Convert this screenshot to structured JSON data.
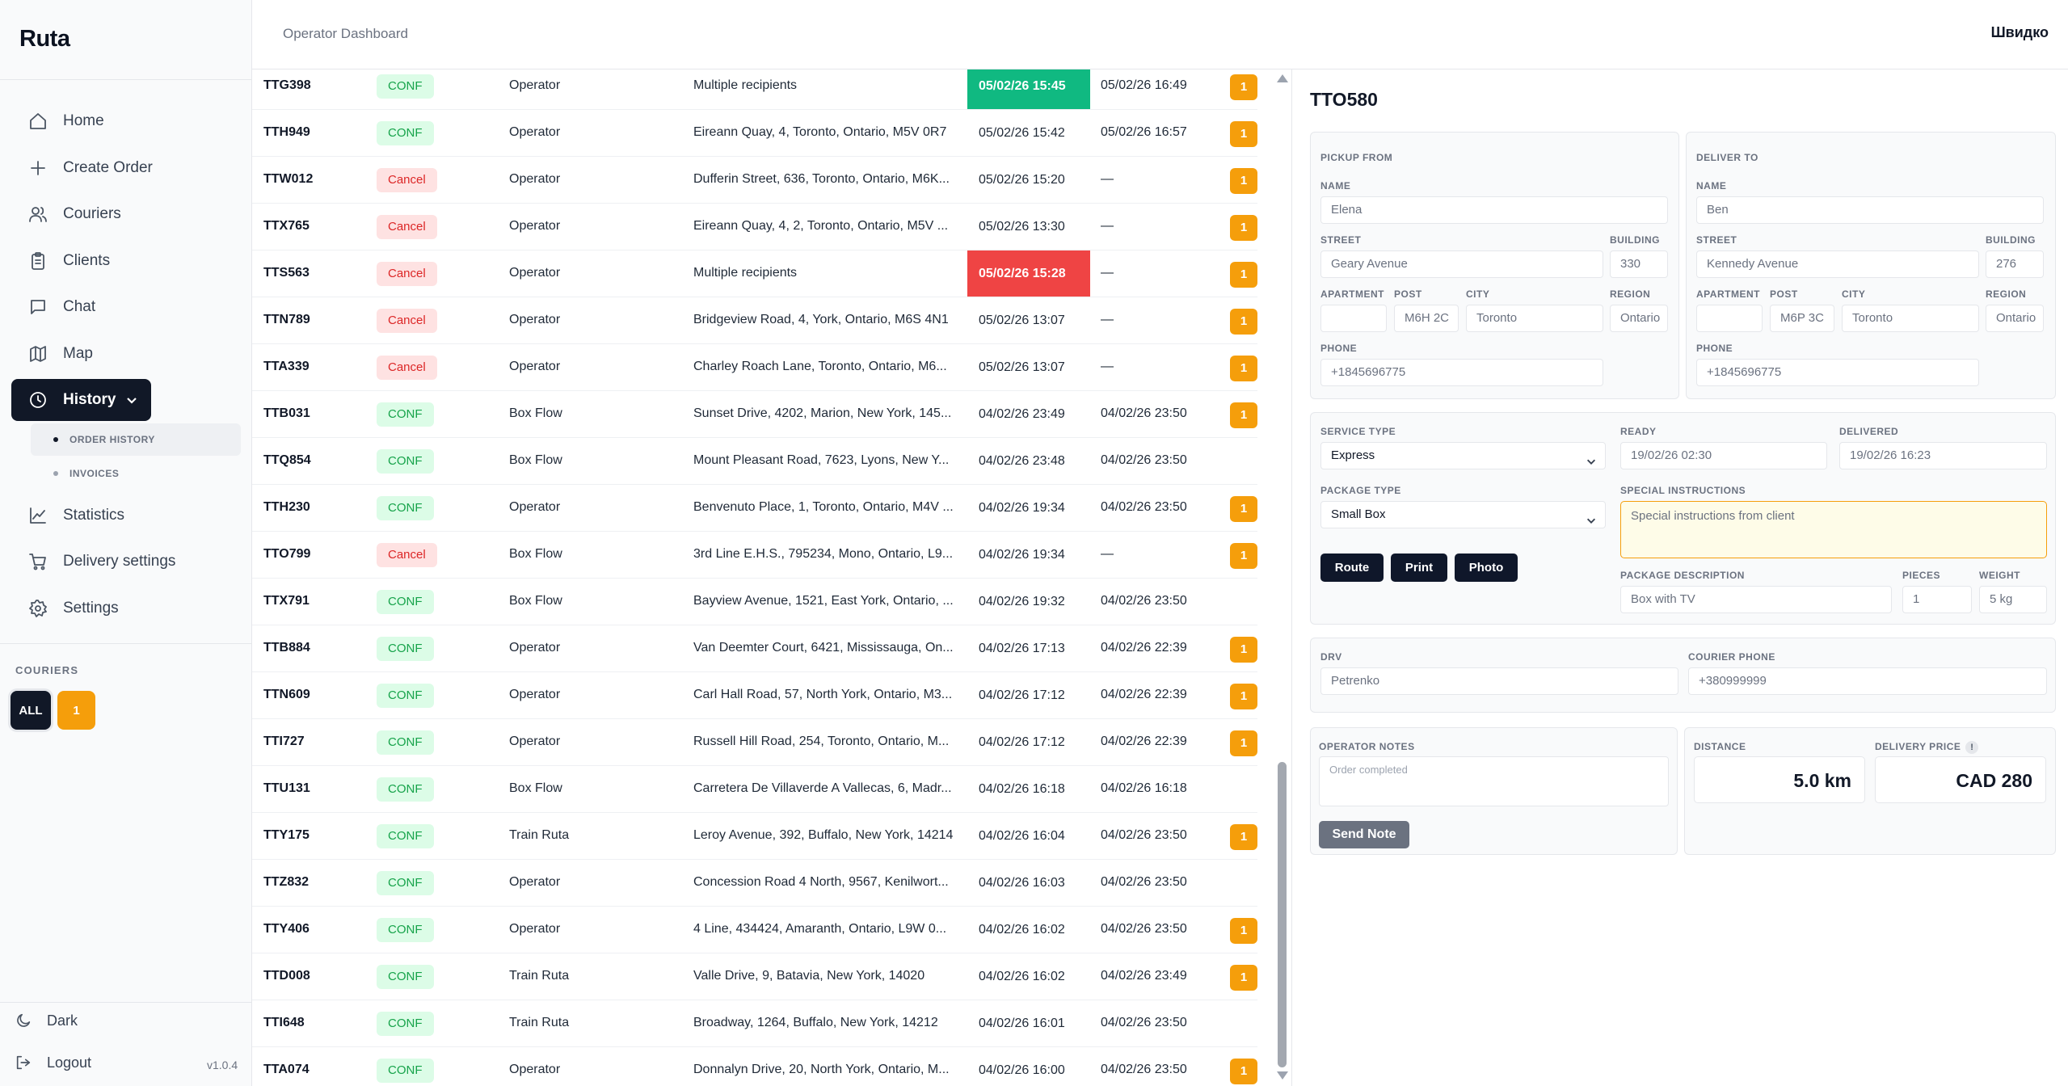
{
  "app": {
    "brand": "Ruta",
    "version": "v1.0.4"
  },
  "header": {
    "title": "Operator Dashboard",
    "lang": "Швидко"
  },
  "sidebar": {
    "items": [
      {
        "label": "Home",
        "icon": "home-icon"
      },
      {
        "label": "Create Order",
        "icon": "plus-icon"
      },
      {
        "label": "Couriers",
        "icon": "users-icon"
      },
      {
        "label": "Clients",
        "icon": "clipboard-icon"
      },
      {
        "label": "Chat",
        "icon": "chat-icon"
      },
      {
        "label": "Map",
        "icon": "map-icon"
      },
      {
        "label": "History",
        "icon": "clock-icon"
      },
      {
        "label": "Statistics",
        "icon": "chart-icon"
      },
      {
        "label": "Delivery settings",
        "icon": "cart-icon"
      },
      {
        "label": "Settings",
        "icon": "gear-icon"
      }
    ],
    "sub_items": [
      {
        "label": "Order History"
      },
      {
        "label": "Invoices"
      }
    ],
    "couriers_title": "COURIERS",
    "courier_all": "ALL",
    "courier_one": "1",
    "dark_label": "Dark",
    "logout_label": "Logout"
  },
  "orders": [
    {
      "id": "TTG398",
      "status": "CONF",
      "source": "Operator",
      "address": "Multiple recipients",
      "time1": "05/02/26 15:45",
      "time2": "05/02/26 16:49",
      "badge": "1",
      "highlight": "green"
    },
    {
      "id": "TTH949",
      "status": "CONF",
      "source": "Operator",
      "address": "Eireann Quay, 4, Toronto, Ontario, M5V 0R7",
      "time1": "05/02/26 15:42",
      "time2": "05/02/26 16:57",
      "badge": "1",
      "highlight": ""
    },
    {
      "id": "TTW012",
      "status": "Cancel",
      "source": "Operator",
      "address": "Dufferin Street, 636, Toronto, Ontario, M6K...",
      "time1": "05/02/26 15:20",
      "time2": "—",
      "badge": "1",
      "highlight": ""
    },
    {
      "id": "TTX765",
      "status": "Cancel",
      "source": "Operator",
      "address": "Eireann Quay, 4, 2, Toronto, Ontario, M5V ...",
      "time1": "05/02/26 13:30",
      "time2": "—",
      "badge": "1",
      "highlight": ""
    },
    {
      "id": "TTS563",
      "status": "Cancel",
      "source": "Operator",
      "address": "Multiple recipients",
      "time1": "05/02/26 15:28",
      "time2": "—",
      "badge": "1",
      "highlight": "red"
    },
    {
      "id": "TTN789",
      "status": "Cancel",
      "source": "Operator",
      "address": "Bridgeview Road, 4, York, Ontario, M6S 4N1",
      "time1": "05/02/26 13:07",
      "time2": "—",
      "badge": "1",
      "highlight": ""
    },
    {
      "id": "TTA339",
      "status": "Cancel",
      "source": "Operator",
      "address": "Charley Roach Lane, Toronto, Ontario, M6...",
      "time1": "05/02/26 13:07",
      "time2": "—",
      "badge": "1",
      "highlight": ""
    },
    {
      "id": "TTB031",
      "status": "CONF",
      "source": "Box Flow",
      "address": "Sunset Drive, 4202, Marion, New York, 145...",
      "time1": "04/02/26 23:49",
      "time2": "04/02/26 23:50",
      "badge": "1",
      "highlight": ""
    },
    {
      "id": "TTQ854",
      "status": "CONF",
      "source": "Box Flow",
      "address": "Mount Pleasant Road, 7623, Lyons, New Y...",
      "time1": "04/02/26 23:48",
      "time2": "04/02/26 23:50",
      "badge": "",
      "highlight": ""
    },
    {
      "id": "TTH230",
      "status": "CONF",
      "source": "Operator",
      "address": "Benvenuto Place, 1, Toronto, Ontario, M4V ...",
      "time1": "04/02/26 19:34",
      "time2": "04/02/26 23:50",
      "badge": "1",
      "highlight": ""
    },
    {
      "id": "TTO799",
      "status": "Cancel",
      "source": "Box Flow",
      "address": "3rd Line E.H.S., 795234, Mono, Ontario, L9...",
      "time1": "04/02/26 19:34",
      "time2": "—",
      "badge": "1",
      "highlight": ""
    },
    {
      "id": "TTX791",
      "status": "CONF",
      "source": "Box Flow",
      "address": "Bayview Avenue, 1521, East York, Ontario, ...",
      "time1": "04/02/26 19:32",
      "time2": "04/02/26 23:50",
      "badge": "",
      "highlight": ""
    },
    {
      "id": "TTB884",
      "status": "CONF",
      "source": "Operator",
      "address": "Van Deemter Court, 6421, Mississauga, On...",
      "time1": "04/02/26 17:13",
      "time2": "04/02/26 22:39",
      "badge": "1",
      "highlight": ""
    },
    {
      "id": "TTN609",
      "status": "CONF",
      "source": "Operator",
      "address": "Carl Hall Road, 57, North York, Ontario, M3...",
      "time1": "04/02/26 17:12",
      "time2": "04/02/26 22:39",
      "badge": "1",
      "highlight": ""
    },
    {
      "id": "TTI727",
      "status": "CONF",
      "source": "Operator",
      "address": "Russell Hill Road, 254, Toronto, Ontario, M...",
      "time1": "04/02/26 17:12",
      "time2": "04/02/26 22:39",
      "badge": "1",
      "highlight": ""
    },
    {
      "id": "TTU131",
      "status": "CONF",
      "source": "Box Flow",
      "address": "Carretera De Villaverde A Vallecas, 6, Madr...",
      "time1": "04/02/26 16:18",
      "time2": "04/02/26 16:18",
      "badge": "",
      "highlight": ""
    },
    {
      "id": "TTY175",
      "status": "CONF",
      "source": "Train Ruta",
      "address": "Leroy Avenue, 392, Buffalo, New York, 14214",
      "time1": "04/02/26 16:04",
      "time2": "04/02/26 23:50",
      "badge": "1",
      "highlight": ""
    },
    {
      "id": "TTZ832",
      "status": "CONF",
      "source": "Operator",
      "address": "Concession Road 4 North, 9567, Kenilwort...",
      "time1": "04/02/26 16:03",
      "time2": "04/02/26 23:50",
      "badge": "",
      "highlight": ""
    },
    {
      "id": "TTY406",
      "status": "CONF",
      "source": "Operator",
      "address": "4 Line, 434424, Amaranth, Ontario, L9W 0...",
      "time1": "04/02/26 16:02",
      "time2": "04/02/26 23:50",
      "badge": "1",
      "highlight": ""
    },
    {
      "id": "TTD008",
      "status": "CONF",
      "source": "Train Ruta",
      "address": "Valle Drive, 9, Batavia, New York, 14020",
      "time1": "04/02/26 16:02",
      "time2": "04/02/26 23:49",
      "badge": "1",
      "highlight": ""
    },
    {
      "id": "TTI648",
      "status": "CONF",
      "source": "Train Ruta",
      "address": "Broadway, 1264, Buffalo, New York, 14212",
      "time1": "04/02/26 16:01",
      "time2": "04/02/26 23:50",
      "badge": "",
      "highlight": ""
    },
    {
      "id": "TTA074",
      "status": "CONF",
      "source": "Operator",
      "address": "Donnalyn Drive, 20, North York, Ontario, M...",
      "time1": "04/02/26 16:00",
      "time2": "04/02/26 23:50",
      "badge": "1",
      "highlight": ""
    }
  ],
  "detail": {
    "title": "TTO580",
    "pickup": {
      "section": "PICKUP FROM",
      "name_label": "NAME",
      "name": "Elena",
      "street_label": "STREET",
      "street": "Geary Avenue",
      "building_label": "BUILDING",
      "building": "330",
      "apartment_label": "APARTMENT",
      "apartment": "",
      "post_label": "POST",
      "post": "M6H 2C",
      "city_label": "CITY",
      "city": "Toronto",
      "region_label": "REGION",
      "region": "Ontario",
      "phone_label": "PHONE",
      "phone": "+1845696775"
    },
    "deliver": {
      "section": "DELIVER TO",
      "name_label": "NAME",
      "name": "Ben",
      "street_label": "STREET",
      "street": "Kennedy Avenue",
      "building_label": "BUILDING",
      "building": "276",
      "apartment_label": "APARTMENT",
      "apartment": "",
      "post_label": "POST",
      "post": "M6P 3C",
      "city_label": "CITY",
      "city": "Toronto",
      "region_label": "REGION",
      "region": "Ontario",
      "phone_label": "PHONE",
      "phone": "+1845696775"
    },
    "service": {
      "service_type_label": "SERVICE TYPE",
      "service_type": "Express",
      "ready_label": "READY",
      "ready": "19/02/26  02:30",
      "delivered_label": "DELIVERED",
      "delivered": "19/02/26  16:23",
      "package_type_label": "PACKAGE TYPE",
      "package_type": "Small Box",
      "special_label": "SPECIAL INSTRUCTIONS",
      "special_placeholder": "Special instructions from client",
      "route_btn": "Route",
      "print_btn": "Print",
      "photo_btn": "Photo",
      "pkg_desc_label": "PACKAGE DESCRIPTION",
      "pkg_desc": "Box with TV",
      "pieces_label": "PIECES",
      "pieces": "1",
      "weight_label": "WEIGHT",
      "weight": "5 kg"
    },
    "courier": {
      "drv_label": "DRV",
      "drv": "Petrenko",
      "phone_label": "COURIER PHONE",
      "phone": "+380999999"
    },
    "notes": {
      "label": "OPERATOR NOTES",
      "placeholder": "Order completed",
      "send_btn": "Send Note"
    },
    "totals": {
      "distance_label": "DISTANCE",
      "distance": "5.0 km",
      "price_label": "DELIVERY PRICE",
      "price_info": "!",
      "price": "CAD 280"
    }
  },
  "colors": {
    "conf_bg": "#dcfce7",
    "conf_text": "#16a34a",
    "cancel_bg": "#fee2e2",
    "cancel_text": "#dc2626",
    "badge": "#f59e0b",
    "highlight_green": "#10b981",
    "highlight_red": "#ef4444"
  }
}
